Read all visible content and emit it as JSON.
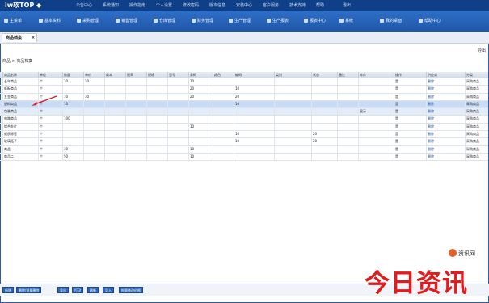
{
  "app": {
    "logo": "iw软TOP ◆"
  },
  "top_links": [
    "公告中心",
    "系统通知",
    "操作指南",
    "个人设置",
    "修改密码",
    "版本信息",
    "安装中心",
    "客户服务",
    "技术支持",
    "帮助",
    "退出"
  ],
  "nav": [
    {
      "label": "主菜单",
      "icon": "home-icon"
    },
    {
      "label": "基本资料",
      "icon": "folder-icon"
    },
    {
      "label": "采购管理",
      "icon": "cart-icon"
    },
    {
      "label": "销售管理",
      "icon": "sale-icon"
    },
    {
      "label": "仓库管理",
      "icon": "warehouse-icon"
    },
    {
      "label": "财务管理",
      "icon": "finance-icon"
    },
    {
      "label": "生产管理",
      "icon": "factory-icon"
    },
    {
      "label": "生产报表",
      "icon": "report-icon"
    },
    {
      "label": "报表中心",
      "icon": "chart-icon"
    },
    {
      "label": "系统",
      "icon": "gear-icon"
    },
    {
      "label": "我的桌面",
      "icon": "desktop-icon"
    },
    {
      "label": "帮助中心",
      "icon": "help-icon"
    }
  ],
  "tab": {
    "label": "商品档案",
    "close": "×"
  },
  "breadcrumb": "商品 > 商品档案",
  "right_link": "导出",
  "columns": [
    "商品名称",
    "单位",
    "数量",
    "单价",
    "成本",
    "税率",
    "规格",
    "型号",
    "条码",
    "颜色",
    "编码",
    "类别",
    "状态",
    "备注",
    "库存",
    "操作",
    "供应商",
    "分类"
  ],
  "rows": [
    [
      "长年商品",
      "个",
      "10",
      "20",
      "",
      "",
      "",
      "",
      "10",
      "",
      "",
      "",
      "",
      "",
      "",
      "是",
      "删除",
      "采购商品"
    ],
    [
      "纸板商品",
      "个",
      "",
      "",
      "",
      "",
      "",
      "",
      "20",
      "",
      "10",
      "",
      "",
      "",
      "",
      "是",
      "删除",
      "采购商品"
    ],
    [
      "五金商品",
      "个",
      "10",
      "30",
      "",
      "",
      "",
      "",
      "20",
      "",
      "20",
      "",
      "",
      "",
      "",
      "是",
      "删除",
      "采购商品"
    ],
    [
      "塑料商品",
      "个",
      "10",
      "",
      "",
      "",
      "",
      "",
      "",
      "",
      "10",
      "",
      "",
      "",
      "",
      "是",
      "删除",
      "采购商品"
    ],
    [
      "包装商品",
      "个",
      "",
      "",
      "",
      "",
      "",
      "",
      "",
      "",
      "",
      "",
      "",
      "",
      "展示",
      "是",
      "删除",
      "采购商品"
    ],
    [
      "电路商品",
      "个",
      "100",
      "",
      "",
      "",
      "",
      "",
      "",
      "",
      "",
      "",
      "",
      "",
      "",
      "是",
      "删除",
      "采购商品"
    ],
    [
      "铝合金片",
      "个",
      "",
      "",
      "",
      "",
      "",
      "",
      "10",
      "",
      "",
      "",
      "",
      "",
      "",
      "是",
      "删除",
      "采购商品"
    ],
    [
      "纸质标签",
      "个",
      "",
      "",
      "",
      "",
      "",
      "",
      "",
      "",
      "10",
      "",
      "20",
      "",
      "",
      "是",
      "删除",
      "采购商品"
    ],
    [
      "玻璃瓶子",
      "个",
      "",
      "",
      "",
      "",
      "",
      "",
      "",
      "",
      "10",
      "",
      "20",
      "",
      "",
      "是",
      "删除",
      "采购商品"
    ],
    [
      "商品一",
      "个",
      "30",
      "",
      "",
      "",
      "",
      "",
      "10",
      "",
      "",
      "",
      "",
      "",
      "",
      "是",
      "删除",
      "采购商品"
    ],
    [
      "商品二",
      "个",
      "50",
      "",
      "",
      "",
      "",
      "",
      "10",
      "",
      "",
      "",
      "",
      "",
      "",
      "是",
      "删除",
      "采购商品"
    ]
  ],
  "bottom_buttons": [
    "新增",
    "删除/批量删除",
    "导出",
    "打印",
    "刷新",
    "导入",
    "批量修改价格"
  ],
  "watermark": {
    "small": "资讯网",
    "big": "今日资讯"
  },
  "colors": {
    "nav": "#1f57a8",
    "topbar": "#0f3f86",
    "selected": "#c9dcf7",
    "watermark": "#e11c1c"
  }
}
